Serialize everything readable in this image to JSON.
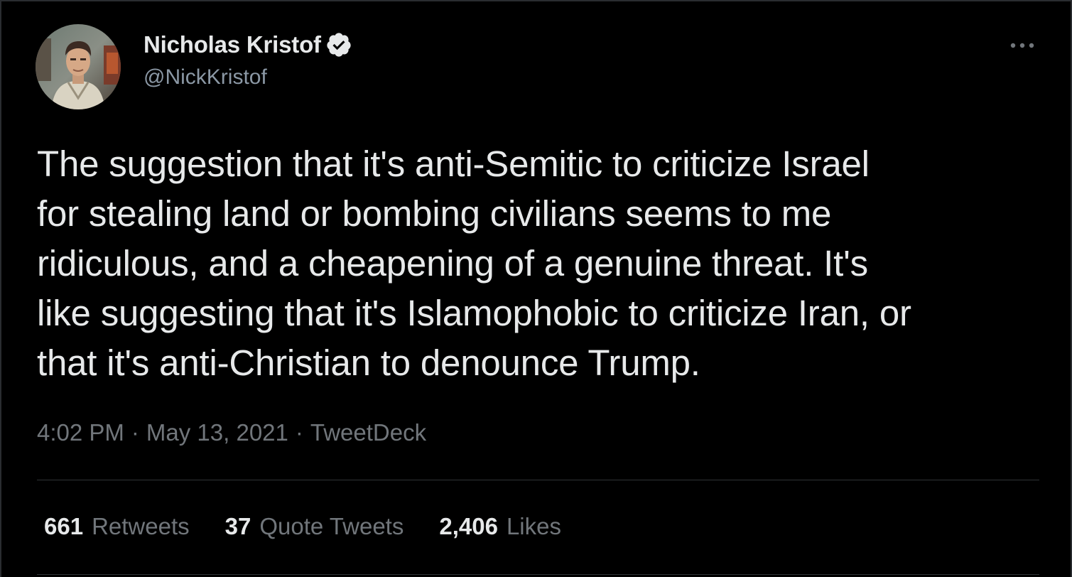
{
  "tweet": {
    "author": {
      "display_name": "Nicholas Kristof",
      "handle": "@NickKristof",
      "verified": true,
      "avatar_icon": "profile-photo"
    },
    "text": "The suggestion that it's anti-Semitic to criticize Israel\nfor stealing land or bombing civilians seems to me\nridiculous, and a cheapening of a genuine threat. It's\nlike suggesting that it's Islamophobic to criticize Iran, or\nthat it's anti-Christian to denounce Trump.",
    "meta": {
      "time": "4:02 PM",
      "separator": "·",
      "date": "May 13, 2021",
      "source": "TweetDeck"
    },
    "stats": {
      "retweets": {
        "count": "661",
        "label": "Retweets"
      },
      "quote_tweets": {
        "count": "37",
        "label": "Quote Tweets"
      },
      "likes": {
        "count": "2,406",
        "label": "Likes"
      }
    },
    "more_icon": "more-horizontal-icon"
  },
  "colors": {
    "background": "#000000",
    "primary_text": "#e7e9ea",
    "secondary_text": "#71767b",
    "handle_text": "#8b98a5",
    "divider": "#2f3336",
    "verified_badge": "#e7e9ea"
  }
}
